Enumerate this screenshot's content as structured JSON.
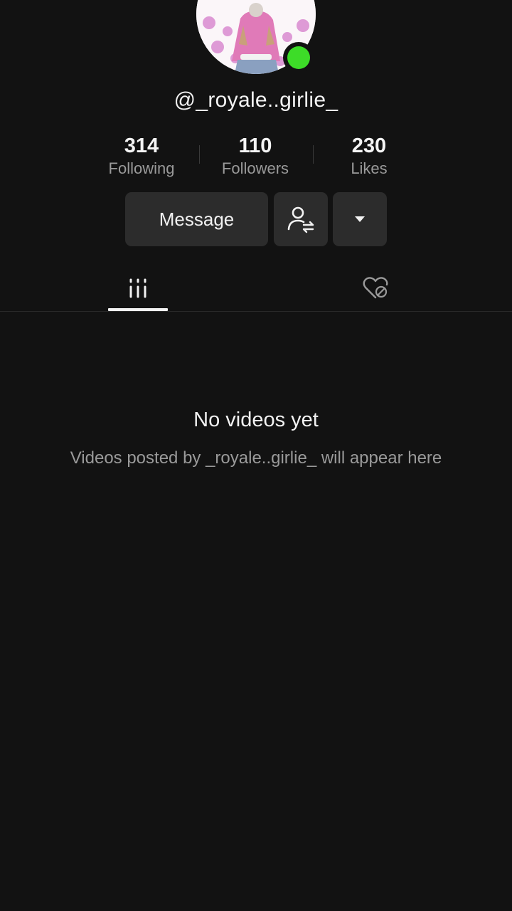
{
  "profile": {
    "username": "@_royale..girlie_",
    "online": true,
    "status_color": "#3ddc28"
  },
  "stats": [
    {
      "value": "314",
      "label": "Following"
    },
    {
      "value": "110",
      "label": "Followers"
    },
    {
      "value": "230",
      "label": "Likes"
    }
  ],
  "actions": {
    "message_label": "Message",
    "friend_icon": "user-switch-icon",
    "more_icon": "caret-down-icon"
  },
  "tabs": [
    {
      "icon": "videos-grid-icon",
      "selected": true
    },
    {
      "icon": "liked-private-icon",
      "selected": false
    }
  ],
  "empty_state": {
    "title": "No videos yet",
    "subtitle": "Videos posted by _royale..girlie_ will appear here"
  }
}
